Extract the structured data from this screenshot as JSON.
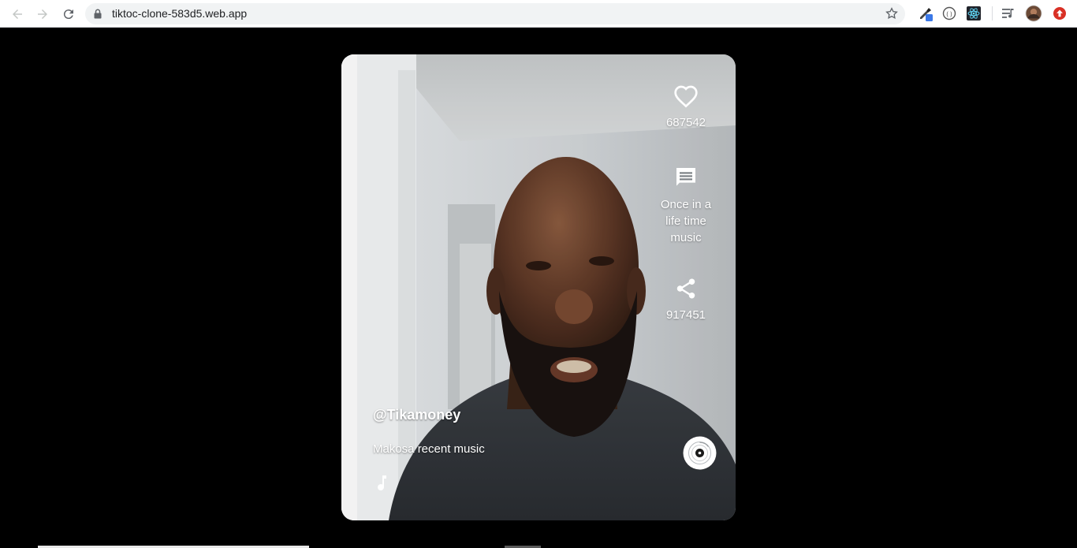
{
  "browser": {
    "url": "tiktoc-clone-583d5.web.app",
    "back_icon": "arrow-left-icon",
    "forward_icon": "arrow-right-icon",
    "reload_icon": "reload-icon",
    "lock_icon": "lock-icon",
    "bookmark_icon": "star-icon",
    "extensions": [
      "eyedropper-icon",
      "devtools-icon",
      "react-devtools-icon",
      "media-queue-icon",
      "profile-avatar",
      "update-icon"
    ]
  },
  "video": {
    "likes": "687542",
    "comment_text": "Once in a life time music",
    "shares": "917451",
    "username": "@Tikamoney",
    "description": "Makosa recent music",
    "like_icon": "heart-icon",
    "comment_icon": "comment-icon",
    "share_icon": "share-icon",
    "music_icon": "music-note-icon",
    "record_icon": "vinyl-record-icon"
  },
  "colors": {
    "page_bg": "#000000",
    "overlay_text": "#ffffff",
    "chrome_bg": "#ffffff",
    "omnibox_bg": "#f1f3f4"
  }
}
